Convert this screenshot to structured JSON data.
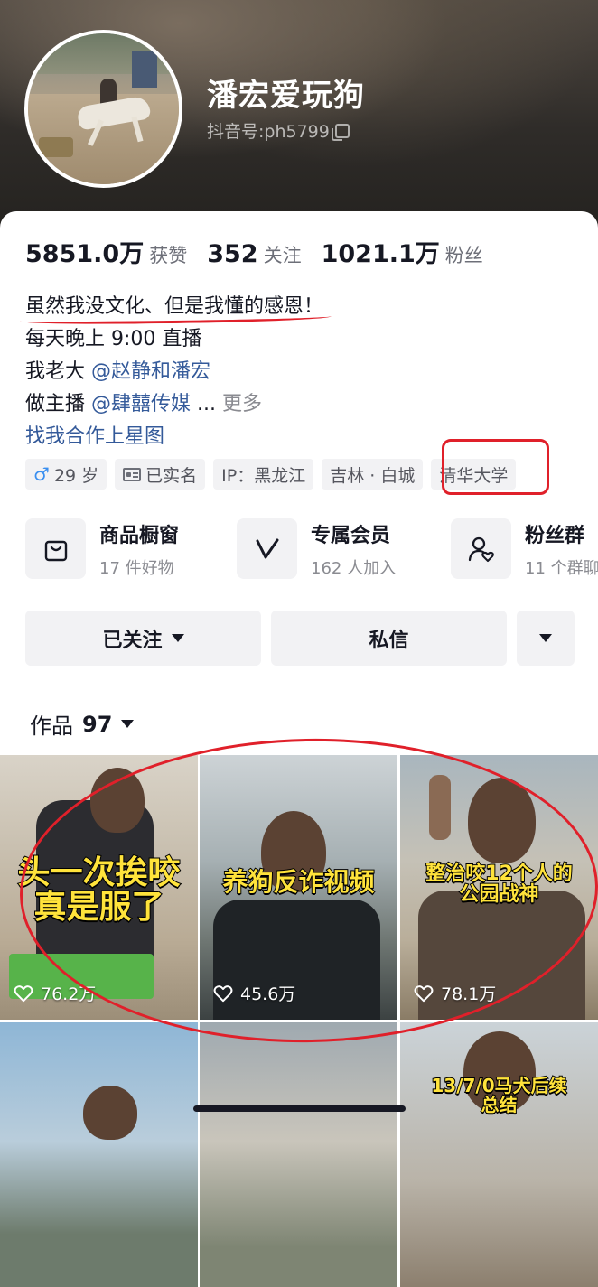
{
  "profile": {
    "nickname": "潘宏爱玩狗",
    "douyin_id": "抖音号:ph5799"
  },
  "stats": [
    {
      "value": "5851.0万",
      "label": "获赞"
    },
    {
      "value": "352",
      "label": "关注"
    },
    {
      "value": "1021.1万",
      "label": "粉丝"
    }
  ],
  "bio": {
    "line1": "虽然我没文化、但是我懂的感恩！",
    "line2": "每天晚上 9:00 直播",
    "line3_prefix": "我老大 ",
    "line3_mention": "@赵静和潘宏",
    "line4_prefix": "做主播 ",
    "line4_mention": "@肆囍传媒",
    "line4_ellipsis": " ...",
    "line4_more": "更多",
    "line5_link": "找我合作上星图"
  },
  "tags": {
    "gender_symbol": "♂",
    "age": "29 岁",
    "verified": "已实名",
    "ip": "IP：黑龙江",
    "location": "吉林 · 白城",
    "school": "清华大学"
  },
  "services": [
    {
      "title": "商品橱窗",
      "subtitle": "17 件好物",
      "icon": "shopping-bag-icon"
    },
    {
      "title": "专属会员",
      "subtitle": "162 人加入",
      "icon": "member-v-icon"
    },
    {
      "title": "粉丝群",
      "subtitle": "11 个群聊",
      "icon": "fan-group-icon"
    }
  ],
  "actions": {
    "follow_label": "已关注",
    "message_label": "私信"
  },
  "works": {
    "label": "作品",
    "count": "97"
  },
  "videos": [
    {
      "caption_line1": "头一次挨咬",
      "caption_line2": "真是服了",
      "likes": "76.2万"
    },
    {
      "caption_line1": "养狗反诈视频",
      "caption_line2": "",
      "likes": "45.6万"
    },
    {
      "caption_line1": "整治咬12个人的",
      "caption_line2": "公园战神",
      "likes": "78.1万"
    },
    {
      "caption_line1": "",
      "caption_line2": "",
      "likes": ""
    },
    {
      "caption_line1": "",
      "caption_line2": "",
      "likes": ""
    },
    {
      "caption_line1": "13/7/0马犬后续",
      "caption_line2": "总结",
      "likes": ""
    }
  ],
  "colors": {
    "annotation_red": "#e0202a",
    "mention_blue": "#345a9a",
    "caption_yellow": "#ffe33b"
  }
}
